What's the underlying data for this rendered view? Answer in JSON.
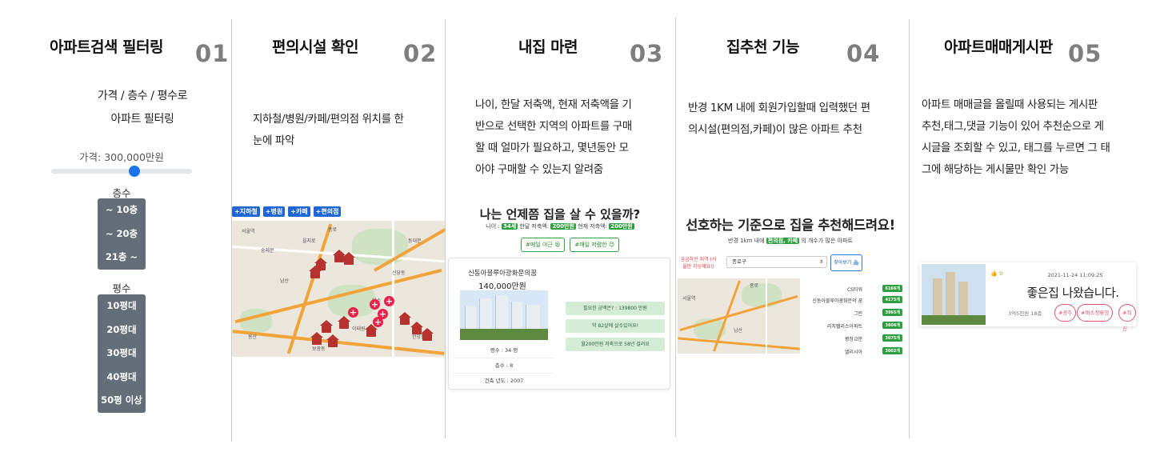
{
  "columns": [
    {
      "title": "아파트검색 필터링",
      "num": "01"
    },
    {
      "title": "편의시설 확인",
      "num": "02"
    },
    {
      "title": "내집 마련",
      "num": "03"
    },
    {
      "title": "집추천 기능",
      "num": "04"
    },
    {
      "title": "아파트매매게시판",
      "num": "05"
    }
  ],
  "col1": {
    "desc_lines": [
      "가격 / 층수 / 평수로",
      "아파트 필터링"
    ],
    "price_label": "가격: 300,000만원",
    "slider_value_pct": 59,
    "floor_label": "층수",
    "floor_options": [
      "~ 10층",
      "~ 20층",
      "21층 ~"
    ],
    "size_label": "평수",
    "size_options": [
      "10평대",
      "20평대",
      "30평대",
      "40평대",
      "50평 이상"
    ],
    "accent": "#1a73e8"
  },
  "col2": {
    "desc_lines": [
      "지하철/병원/카페/편의점 위치를 한",
      "눈에 파악"
    ],
    "tags": [
      "+지하철",
      "+병원",
      "+카페",
      "+편의점"
    ],
    "map_labels": [
      "서울역",
      "숭례문",
      "을지로",
      "종로",
      "남산",
      "이태원",
      "용산",
      "신당동",
      "약수",
      "동대문",
      "한강진",
      "보광동"
    ]
  },
  "col3": {
    "desc_lines": [
      "나이, 한달 저축액, 현재 저축액을 기",
      "반으로 선택한 지역의 아파트를 구매",
      "할 때 얼마가 필요하고, 몇년동안 모",
      "아야 구매할 수 있는지 알려줌"
    ],
    "heading": "나는 언제쯤 집을 살 수 있을까?",
    "sub_age": "나이 :",
    "age_badge": "34세",
    "sub_monthly": "한달 저축액:",
    "monthly_badge": "200만원",
    "sub_current": "현재 저축액:",
    "current_badge": "200만원",
    "btn_left": "#매일 야근 😫",
    "btn_right": "#매일 저렴한 😊",
    "apt_name": "신동아블루아광화문의꿈",
    "apt_price": "140,000만원",
    "stats": [
      "평수 : 34 평",
      "층수 : 8",
      "건축 년도 : 2007"
    ],
    "results": [
      "필요한 금액은? : 139800 만원",
      "약 82살에 살수있어요!",
      "월200만원 저축으로 58년 걸려요"
    ]
  },
  "col4": {
    "desc_lines": [
      "반경 1KM 내에 회원가입할때 입력했던 편",
      "의시설(편의점,카페)이 많은 아파트 추천"
    ],
    "heading": "선호하는 기준으로 집을 추천해드려요!",
    "sub_prefix": "반경 1km 내에",
    "sub_badge": "편의점, 카페",
    "sub_suffix": "의 개수가 많은 아파트",
    "hint": "궁금하신 지역 (서울만 가능해요!)",
    "select_value": "종로구",
    "btn": "찾아보기 🏘",
    "recs": [
      {
        "name": "CS타워",
        "score": "6166개"
      },
      {
        "name": "신동아블루아광화문의 꿈",
        "score": "4175개"
      },
      {
        "name": "그린",
        "score": "3965개"
      },
      {
        "name": "리치팰리스아파트",
        "score": "3606개"
      },
      {
        "name": "평창교문",
        "score": "3075개"
      },
      {
        "name": "엘리시아",
        "score": "3002개"
      }
    ]
  },
  "col5": {
    "desc_lines": [
      "아파트 매매글을 올릴때 사용되는 게시판",
      "추천,태그,댓글 기능이 있어 추천순으로 게",
      "시글을 조회할 수 있고, 태그를 누르면 그 태",
      "그에 해당하는 게시물만 확인 가능"
    ],
    "like": "👍 0",
    "date": "2021-11-24 11:09:25",
    "title": "좋은집 나왔습니다.",
    "meta": "3억5천원 18층",
    "hashtags": [
      "#광주",
      "#버스정류장",
      "#최신"
    ]
  }
}
